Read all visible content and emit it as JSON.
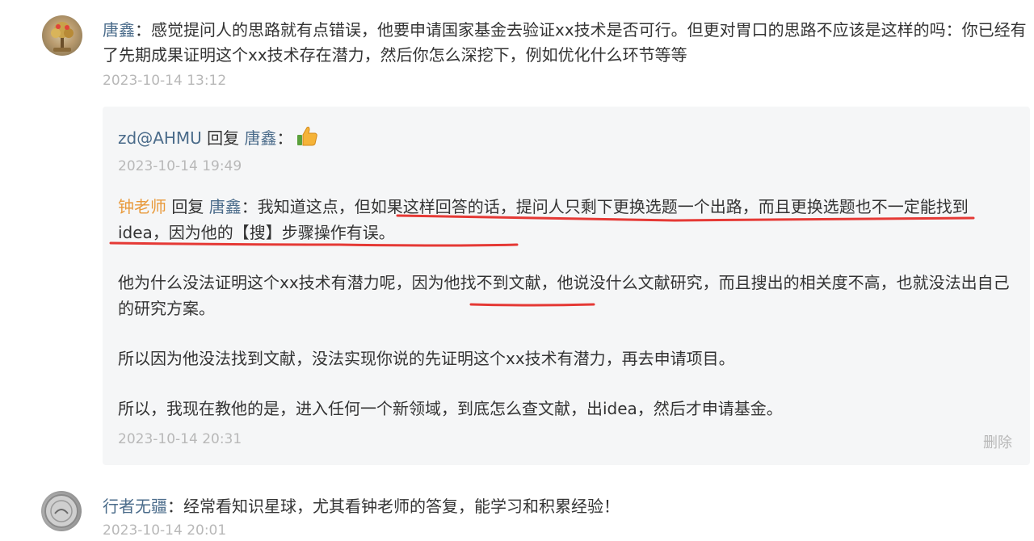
{
  "comment1": {
    "author": "唐鑫",
    "separator": "：",
    "text": "感觉提问人的思路就有点错误，他要申请国家基金去验证xx技术是否可行。但更对胃口的思路不应该是这样的吗：你已经有了先期成果证明这个xx技术存在潜力，然后你怎么深挖下，例如优化什么环节等等",
    "time": "2023-10-14 13:12"
  },
  "reply1": {
    "author": "zd@AHMU",
    "reply_word": "回复",
    "target": "唐鑫",
    "separator": "：",
    "emoji": "thumbs-up-icon",
    "time": "2023-10-14 19:49"
  },
  "reply2": {
    "author": "钟老师",
    "reply_word": "回复",
    "target": "唐鑫",
    "separator": "：",
    "para1": "我知道这点，但如果这样回答的话，提问人只剩下更换选题一个出路，而且更换选题也不一定能找到idea，因为他的【搜】步骤操作有误。",
    "para2": "他为什么没法证明这个xx技术有潜力呢，因为他找不到文献，他说没什么文献研究，而且搜出的相关度不高，也就没法出自己的研究方案。",
    "para3": "所以因为他没法找到文献，没法实现你说的先证明这个xx技术有潜力，再去申请项目。",
    "para4": "所以，我现在教他的是，进入任何一个新领域，到底怎么查文献，出idea，然后才申请基金。",
    "time": "2023-10-14 20:31",
    "delete_label": "删除"
  },
  "comment3": {
    "author": "行者无疆",
    "separator": "：",
    "text": "经常看知识星球，尤其看钟老师的答复，能学习和积累经验！",
    "time": "2023-10-14 20:01"
  },
  "colors": {
    "name_blue": "#4a6b8a",
    "name_orange": "#e89a3c",
    "timestamp_gray": "#b8b8b8",
    "underline_red": "#e53935",
    "reply_bg": "#f5f6f7"
  }
}
